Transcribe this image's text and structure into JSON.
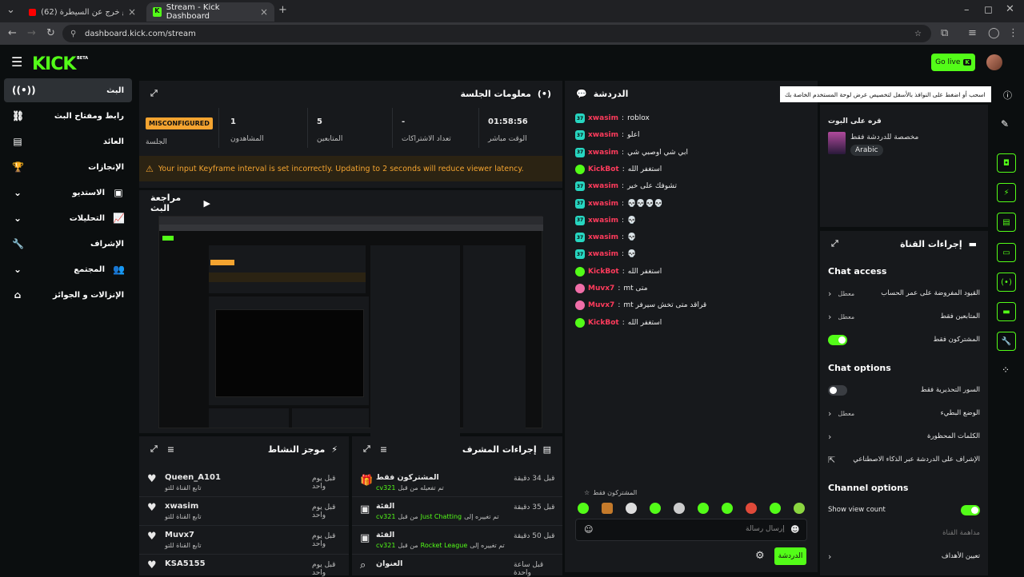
{
  "browser": {
    "tabs": [
      {
        "title": "(62) الوضع خرج عن السيطرة...",
        "active": false
      },
      {
        "title": "Stream - Kick Dashboard",
        "active": true
      }
    ],
    "url": "dashboard.kick.com/stream"
  },
  "header": {
    "logo": "KICK",
    "beta": "BETA",
    "go_live": "Go live"
  },
  "sidebar": {
    "items": [
      {
        "label": "البث",
        "icon": "broadcast-icon"
      },
      {
        "label": "رابط ومفتاح البث",
        "icon": "link-icon"
      },
      {
        "label": "العائد",
        "icon": "chart-icon"
      },
      {
        "label": "الإنجازات",
        "icon": "trophy-icon"
      },
      {
        "label": "الاستديو",
        "icon": "studio-icon"
      },
      {
        "label": "التحليلات",
        "icon": "analytics-icon"
      },
      {
        "label": "الإشراف",
        "icon": "wrench-icon"
      },
      {
        "label": "المجتمع",
        "icon": "community-icon"
      },
      {
        "label": "الإنزالات و الجوائز",
        "icon": "drops-icon"
      }
    ]
  },
  "session": {
    "title": "معلومات الجلسة",
    "status_badge": "MISCONFIGURED",
    "status_label": "الجلسة",
    "stats": [
      {
        "value": "1",
        "label": "المشاهدون"
      },
      {
        "value": "5",
        "label": "المتابعين"
      },
      {
        "value": "-",
        "label": "تعداد الاشتراكات"
      },
      {
        "value": "01:58:56",
        "label": "الوقت مباشر"
      }
    ],
    "warning": "Your input Keyframe interval is set incorrectly. Updating to 2 seconds will reduce viewer latency."
  },
  "preview": {
    "title": "مراجعة البث"
  },
  "activity": {
    "title": "موجز النشاط",
    "items": [
      {
        "name": "Queen_A101",
        "sub": "تابع القناة للتو",
        "time": "قبل يوم واحد"
      },
      {
        "name": "xwasim",
        "sub": "تابع القناة للتو",
        "time": "قبل يوم واحد"
      },
      {
        "name": "Muvx7",
        "sub": "تابع القناة للتو",
        "time": "قبل يوم واحد"
      },
      {
        "name": "KSA5155",
        "sub": "",
        "time": "قبل يوم واحد"
      }
    ]
  },
  "mod_actions": {
    "title": "إجراءات المشرف",
    "items": [
      {
        "title": "المشتركون فقط",
        "pre": "تم تفعيله من قبل",
        "user": "cv321",
        "mid": "",
        "mid_green": "",
        "time": "قبل 34 دقيقة"
      },
      {
        "title": "الفئة",
        "pre": "من قبل",
        "user": "cv321",
        "mid": "تم تغييره إلى",
        "mid_green": "Just Chatting",
        "time": "قبل 35 دقيقة"
      },
      {
        "title": "الفئة",
        "pre": "من قبل",
        "user": "cv321",
        "mid": "تم تغييره إلى",
        "mid_green": "Rocket League",
        "time": "قبل 50 دقيقة"
      },
      {
        "title": "العنوان",
        "pre": "",
        "user": "",
        "mid": "",
        "mid_green": "",
        "time": "قبل ساعة واحدة"
      }
    ]
  },
  "chat": {
    "title": "الدردشة",
    "messages": [
      {
        "user": "xwasim",
        "text": "roblox",
        "badge": "sub",
        "color": "#ff3b5c"
      },
      {
        "user": "xwasim",
        "text": "اعلو",
        "badge": "sub",
        "color": "#ff3b5c"
      },
      {
        "user": "xwasim",
        "text": "ابي شي اوصبي شي",
        "badge": "sub",
        "color": "#ff3b5c"
      },
      {
        "user": "KickBot",
        "text": "استغفر الله",
        "badge": "bot",
        "color": "#ff3b5c"
      },
      {
        "user": "xwasim",
        "text": "تشوفك على خير",
        "badge": "sub",
        "color": "#ff3b5c"
      },
      {
        "user": "xwasim",
        "text": "💀💀💀💀",
        "badge": "sub",
        "color": "#ff3b5c"
      },
      {
        "user": "xwasim",
        "text": "💀",
        "badge": "sub",
        "color": "#ff3b5c"
      },
      {
        "user": "xwasim",
        "text": "💀",
        "badge": "sub",
        "color": "#ff3b5c"
      },
      {
        "user": "xwasim",
        "text": "💀",
        "badge": "sub",
        "color": "#ff3b5c"
      },
      {
        "user": "KickBot",
        "text": "استغفر الله",
        "badge": "bot",
        "color": "#ff3b5c"
      },
      {
        "user": "Muvx7",
        "text": "mt متى",
        "badge": "pink",
        "color": "#ff3b5c"
      },
      {
        "user": "Muvx7",
        "text": "mt قراقد متى تخش سيرفر",
        "badge": "pink",
        "color": "#ff3b5c"
      },
      {
        "user": "KickBot",
        "text": "استغفر الله",
        "badge": "bot",
        "color": "#ff3b5c"
      }
    ],
    "subscribers_only": "المشتركون فقط",
    "input_placeholder": "إرسال رسالة",
    "send_label": "الدردشة"
  },
  "tooltip": "اسحب أو اضغط على النوافذ بالأسفل لتخصيص عرض لوحة المستخدم الخاصة بك",
  "stream_info": {
    "title": "قره على البوت",
    "category": "مخصصة للدردشة فقط",
    "language": "Arabic"
  },
  "channel_actions": {
    "title": "إجراءات القناة",
    "chat_access_heading": "Chat access",
    "chat_access": [
      {
        "label": "القيود المفروضة على عمر الحساب",
        "value": "معطل",
        "type": "link"
      },
      {
        "label": "المتابعين فقط",
        "value": "معطل",
        "type": "link"
      },
      {
        "label": "المشتركون فقط",
        "value": "",
        "type": "toggle-on"
      }
    ],
    "chat_options_heading": "Chat options",
    "chat_options": [
      {
        "label": "السور التحذيرية فقط",
        "value": "",
        "type": "toggle-off"
      },
      {
        "label": "الوضع البطيء",
        "value": "معطل",
        "type": "link"
      },
      {
        "label": "الكلمات المحظورة",
        "value": "",
        "type": "link"
      },
      {
        "label": "الإشراف على الدردشة عبر الذكاء الاصطناعي",
        "value": "",
        "type": "external"
      }
    ],
    "channel_options_heading": "Channel options",
    "channel_options": [
      {
        "label": "Show view count",
        "value": "",
        "type": "toggle-on"
      },
      {
        "label": "مداهمة القناة",
        "value": "",
        "type": "disabled"
      },
      {
        "label": "تعيين الأهداف",
        "value": "",
        "type": "link"
      }
    ]
  },
  "colors": {
    "accent": "#53fc18",
    "bg": "#0b0e0f",
    "panel": "#17191c"
  }
}
